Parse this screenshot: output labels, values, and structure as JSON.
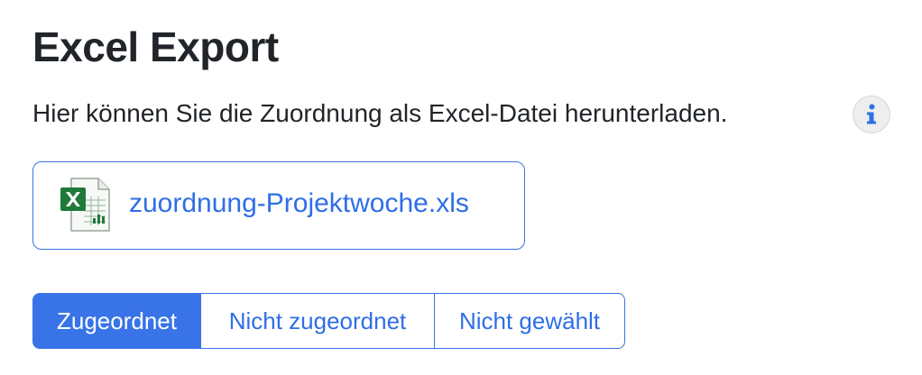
{
  "page": {
    "title": "Excel Export",
    "description": "Hier können Sie die Zuordnung als Excel-Datei herunterladen.",
    "info_icon": "info-icon"
  },
  "download": {
    "file_name": "zuordnung-Projektwoche.xls",
    "icon": "excel-file-icon"
  },
  "filter": {
    "options": [
      {
        "label": "Zugeordnet",
        "active": true
      },
      {
        "label": "Nicht zugeordnet",
        "active": false
      },
      {
        "label": "Nicht gewählt",
        "active": false
      }
    ]
  },
  "colors": {
    "accent": "#3874e8",
    "link": "#2f6ee6",
    "text": "#212529",
    "excel_green": "#1f7a3a"
  }
}
